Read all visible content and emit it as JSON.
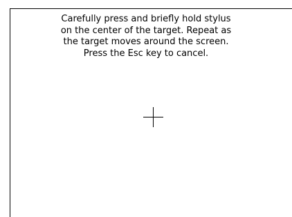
{
  "calibration": {
    "instruction_lines": [
      "Carefully press and briefly hold stylus",
      "on the center of the target.  Repeat as",
      "the target moves around the screen.",
      "Press the Esc key to cancel."
    ],
    "target_icon": "crosshair-icon"
  }
}
